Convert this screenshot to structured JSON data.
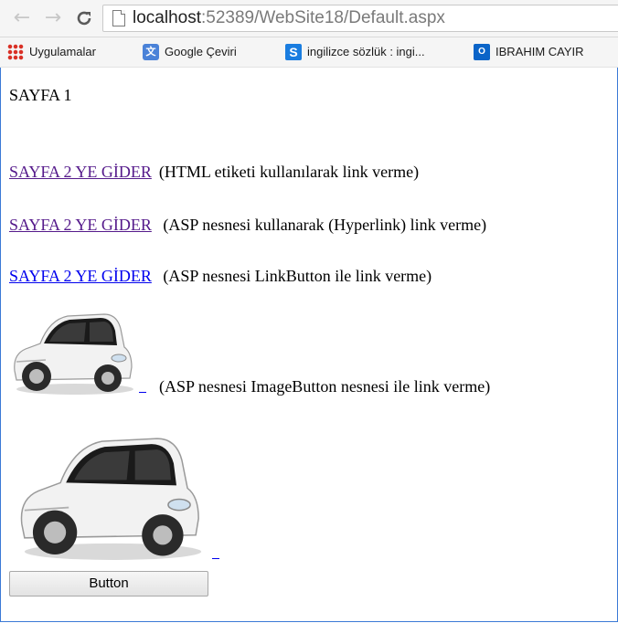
{
  "browser": {
    "url_host": "localhost",
    "url_path": ":52389/WebSite18/Default.aspx"
  },
  "bookmarks": [
    {
      "label": "Uygulamalar",
      "icon": "apps-grid-icon"
    },
    {
      "label": "Google Çeviri",
      "icon": "google-translate-icon"
    },
    {
      "label": "ingilizce sözlük : ingi...",
      "icon": "s-site-icon"
    },
    {
      "label": "IBRAHIM CAYIR",
      "icon": "outlook-icon"
    }
  ],
  "page": {
    "title": "SAYFA 1",
    "links": [
      {
        "link_text": "SAYFA 2 YE GİDER",
        "desc": "(HTML etiketi kullanılarak link verme)"
      },
      {
        "link_text": "SAYFA 2 YE GİDER",
        "desc": " (ASP nesnesi kullanarak (Hyperlink) link verme)"
      },
      {
        "link_text": "SAYFA 2 YE GİDER",
        "desc": "  (ASP nesnesi LinkButton ile link verme)"
      }
    ],
    "image_button_desc": "(ASP nesnesi ImageButton nesnesi ile link verme)",
    "button_label": "Button"
  },
  "colors": {
    "visited_link": "#551a8b",
    "unvisited_link": "#0000ee",
    "window_border": "#3b7ad6"
  }
}
